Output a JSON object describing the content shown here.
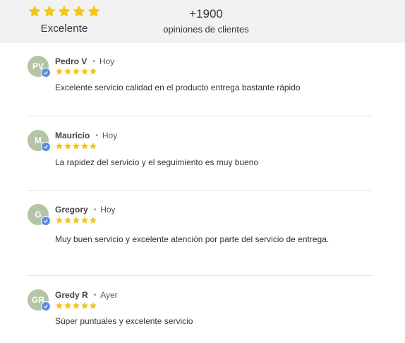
{
  "summary": {
    "rating_label": "Excelente",
    "count": "+1900",
    "count_label": "opiniones de clientes",
    "star_color": "#f5c518"
  },
  "reviews": [
    {
      "initials": "PV",
      "author": "Pedro V",
      "when": "Hoy",
      "rating": 5,
      "text": "Excelente servicio calidad en el producto entrega bastante rápido"
    },
    {
      "initials": "M",
      "author": "Mauricio",
      "when": "Hoy",
      "rating": 5,
      "text": "La rapidez del servicio y el seguimiento es muy bueno"
    },
    {
      "initials": "G",
      "author": "Gregory",
      "when": "Hoy",
      "rating": 5,
      "text": "Muy buen servicio y excelente atención por parte del servicio de entrega."
    },
    {
      "initials": "GR",
      "author": "Gredy R",
      "when": "Ayer",
      "rating": 5,
      "text": "Súper puntuales y excelente servicio"
    }
  ],
  "separator": "•",
  "icons": {
    "star": "star-icon",
    "verified": "verified-check-icon"
  }
}
